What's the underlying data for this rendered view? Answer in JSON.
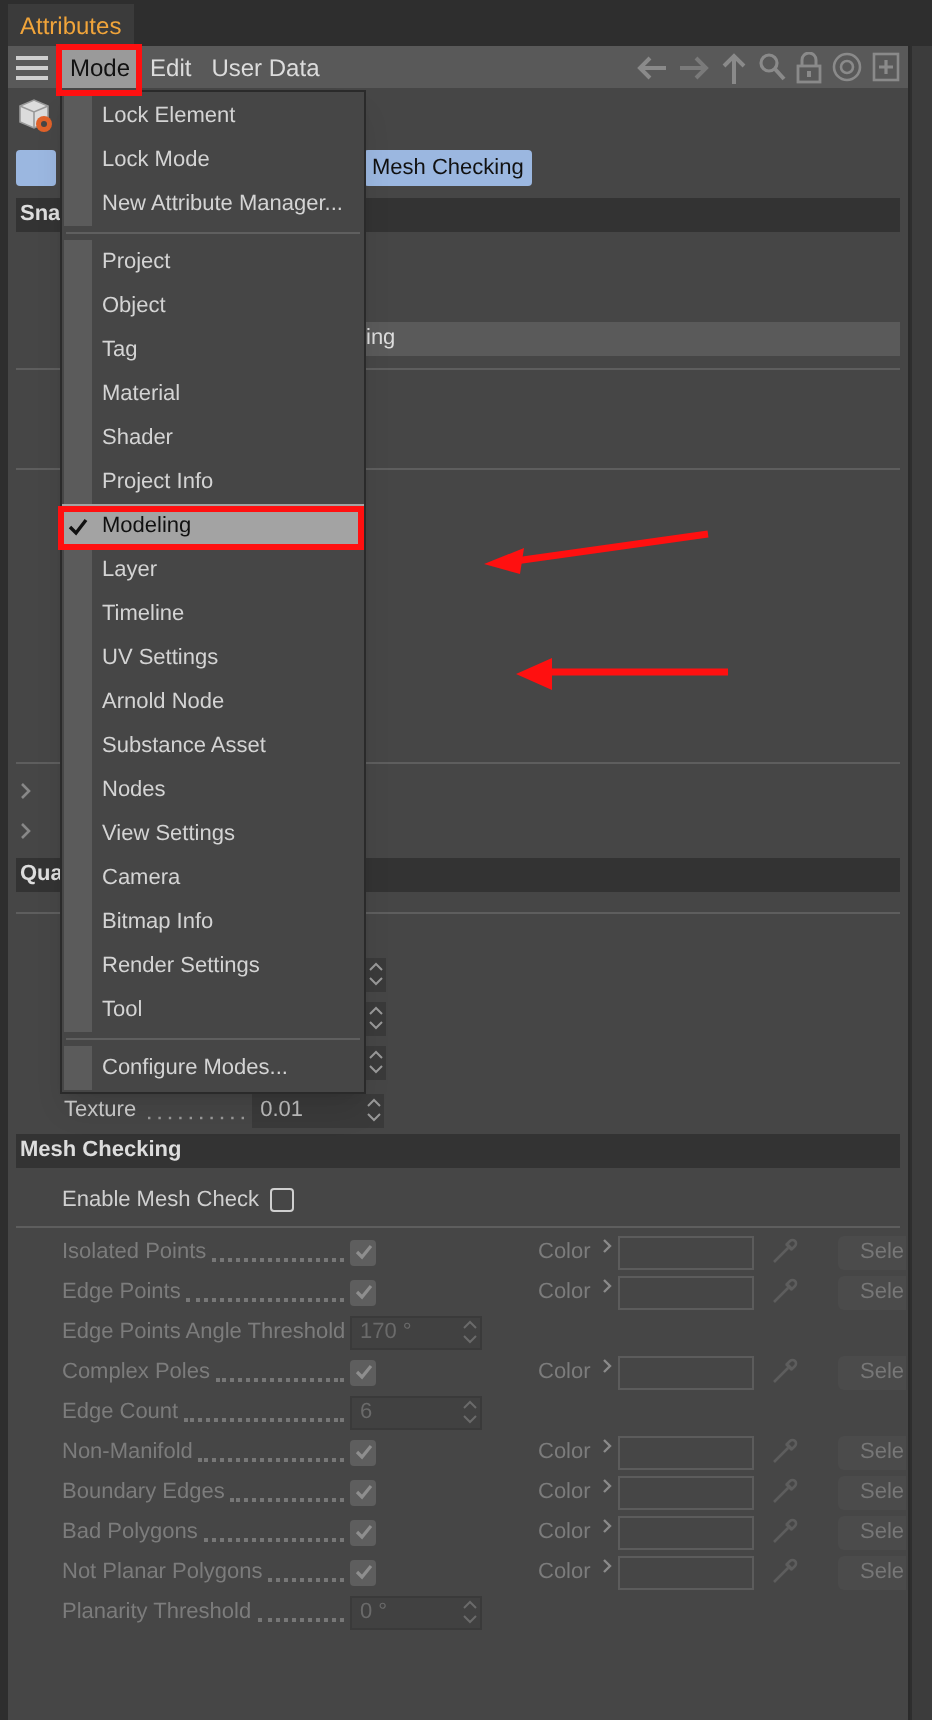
{
  "panel_tab": {
    "label": "Attributes",
    "selected": true
  },
  "menubar": [
    {
      "label": "Mode",
      "selected": true
    },
    {
      "label": "Edit",
      "selected": false
    },
    {
      "label": "User Data",
      "selected": false
    }
  ],
  "tabs": [
    {
      "label": "Mesh Checking",
      "selected": true
    }
  ],
  "hidden_panel": {
    "section_1": "Sna",
    "field_1": "ing",
    "section_2": "Qua",
    "texture": {
      "label": "Texture",
      "value": "0.01"
    }
  },
  "mode_menu": {
    "groups": [
      [
        {
          "label": "Lock Element",
          "checked": false,
          "selected": false
        },
        {
          "label": "Lock Mode",
          "checked": false,
          "selected": false
        },
        {
          "label": "New Attribute Manager...",
          "checked": false,
          "selected": false
        }
      ],
      [
        {
          "label": "Project",
          "checked": false,
          "selected": false
        },
        {
          "label": "Object",
          "checked": false,
          "selected": false
        },
        {
          "label": "Tag",
          "checked": false,
          "selected": false
        },
        {
          "label": "Material",
          "checked": false,
          "selected": false
        },
        {
          "label": "Shader",
          "checked": false,
          "selected": false
        },
        {
          "label": "Project Info",
          "checked": false,
          "selected": false
        },
        {
          "label": "Modeling",
          "checked": true,
          "selected": true
        },
        {
          "label": "Layer",
          "checked": false,
          "selected": false
        },
        {
          "label": "Timeline",
          "checked": false,
          "selected": false
        },
        {
          "label": "UV Settings",
          "checked": false,
          "selected": false
        },
        {
          "label": "Arnold Node",
          "checked": false,
          "selected": false
        },
        {
          "label": "Substance Asset",
          "checked": false,
          "selected": false
        },
        {
          "label": "Nodes",
          "checked": false,
          "selected": false
        },
        {
          "label": "View Settings",
          "checked": false,
          "selected": false
        },
        {
          "label": "Camera",
          "checked": false,
          "selected": false
        },
        {
          "label": "Bitmap Info",
          "checked": false,
          "selected": false
        },
        {
          "label": "Render Settings",
          "checked": false,
          "selected": false
        },
        {
          "label": "Tool",
          "checked": false,
          "selected": false
        }
      ],
      [
        {
          "label": "Configure Modes...",
          "checked": false,
          "selected": false
        }
      ]
    ]
  },
  "mesh_checking": {
    "title": "Mesh Checking",
    "enable": {
      "label": "Enable Mesh Check",
      "checked": false
    },
    "options_disabled": true,
    "rows": [
      {
        "kind": "check",
        "label": "Isolated Points",
        "checked": true,
        "color_label": "Color",
        "button": "Sele"
      },
      {
        "kind": "check",
        "label": "Edge Points",
        "checked": true,
        "color_label": "Color",
        "button": "Sele"
      },
      {
        "kind": "number",
        "label": "Edge Points Angle Threshold",
        "value": "170 °"
      },
      {
        "kind": "check",
        "label": "Complex Poles",
        "checked": true,
        "color_label": "Color",
        "button": "Sele"
      },
      {
        "kind": "number",
        "label": "Edge Count",
        "value": "6"
      },
      {
        "kind": "check",
        "label": "Non-Manifold",
        "checked": true,
        "color_label": "Color",
        "button": "Sele"
      },
      {
        "kind": "check",
        "label": "Boundary Edges",
        "checked": true,
        "color_label": "Color",
        "button": "Sele"
      },
      {
        "kind": "check",
        "label": "Bad Polygons",
        "checked": true,
        "color_label": "Color",
        "button": "Sele"
      },
      {
        "kind": "check",
        "label": "Not Planar Polygons",
        "checked": true,
        "color_label": "Color",
        "button": "Sele"
      },
      {
        "kind": "number",
        "label": "Planarity Threshold",
        "value": "0 °"
      }
    ]
  }
}
